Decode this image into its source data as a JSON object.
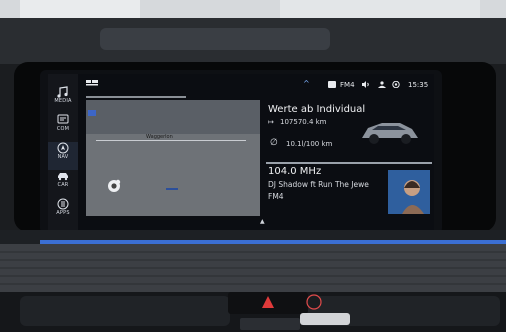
{
  "sidebar": {
    "items": [
      {
        "label": "MEDIA",
        "icon": "music-note-icon"
      },
      {
        "label": "COM",
        "icon": "phone-message-icon"
      },
      {
        "label": "NAV",
        "icon": "navigation-icon",
        "active": true
      },
      {
        "label": "CAR",
        "icon": "car-icon"
      },
      {
        "label": "APPS",
        "icon": "apps-icon"
      }
    ]
  },
  "status": {
    "media_source": "FM4",
    "time": "15:35"
  },
  "map": {
    "street_label": "Waggerlon"
  },
  "vehicle_card": {
    "title": "Werte ab Individual",
    "distance": "107570.4 km",
    "consumption": "10.1l/100 km"
  },
  "radio_card": {
    "frequency": "104.0 MHz",
    "track": "DJ Shadow ft Run The Jewe",
    "station": "FM4"
  },
  "colors": {
    "accent": "#4d7fd1",
    "panel": "#0b0d12",
    "ambient_strip": "#3b6fd4"
  }
}
